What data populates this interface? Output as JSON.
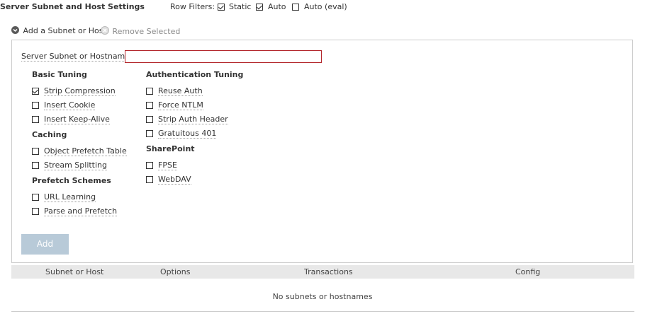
{
  "header": {
    "title": "Server Subnet and Host Settings",
    "row_filters_label": "Row Filters:",
    "filters": [
      {
        "label": "Static",
        "checked": true
      },
      {
        "label": "Auto",
        "checked": true
      },
      {
        "label": "Auto (eval)",
        "checked": false
      }
    ]
  },
  "actions": {
    "add_label": "Add a Subnet or Host",
    "remove_label": "Remove Selected"
  },
  "form": {
    "host_label": "Server Subnet or Hostname:",
    "host_value": "",
    "basic_tuning": {
      "title": "Basic Tuning",
      "options": [
        {
          "label": "Strip Compression",
          "checked": true
        },
        {
          "label": "Insert Cookie",
          "checked": false
        },
        {
          "label": "Insert Keep-Alive",
          "checked": false
        }
      ]
    },
    "caching": {
      "title": "Caching",
      "options": [
        {
          "label": "Object Prefetch Table",
          "checked": false
        },
        {
          "label": "Stream Splitting",
          "checked": false
        }
      ]
    },
    "prefetch": {
      "title": "Prefetch Schemes",
      "options": [
        {
          "label": "URL Learning",
          "checked": false
        },
        {
          "label": "Parse and Prefetch",
          "checked": false
        }
      ]
    },
    "auth_tuning": {
      "title": "Authentication Tuning",
      "options": [
        {
          "label": "Reuse Auth",
          "checked": false
        },
        {
          "label": "Force NTLM",
          "checked": false
        },
        {
          "label": "Strip Auth Header",
          "checked": false
        },
        {
          "label": "Gratuitous 401",
          "checked": false
        }
      ]
    },
    "sharepoint": {
      "title": "SharePoint",
      "options": [
        {
          "label": "FPSE",
          "checked": false
        },
        {
          "label": "WebDAV",
          "checked": false
        }
      ]
    },
    "add_button": "Add"
  },
  "table": {
    "columns": [
      "Subnet or Host",
      "Options",
      "Transactions",
      "Config"
    ],
    "empty_message": "No subnets or hostnames"
  },
  "colors": {
    "input_border": "#b3262b",
    "button_disabled": "#b8cad8",
    "table_header_bg": "#e8e8e8"
  }
}
